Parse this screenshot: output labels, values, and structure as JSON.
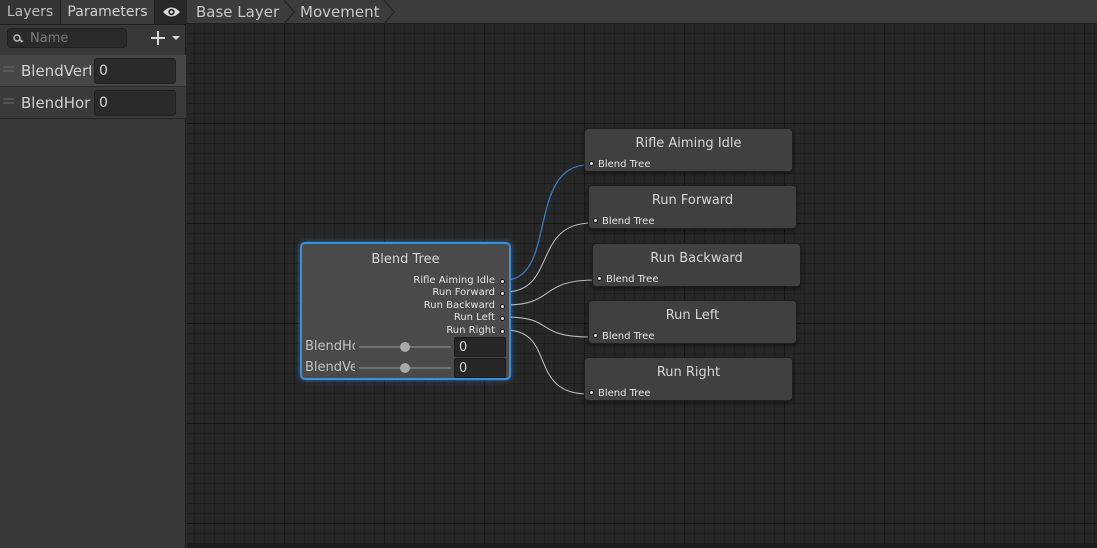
{
  "tabs": {
    "layers": "Layers",
    "parameters": "Parameters"
  },
  "search": {
    "placeholder": "Name",
    "value": ""
  },
  "parameters": [
    {
      "name": "BlendVert",
      "value": "0"
    },
    {
      "name": "BlendHori",
      "value": "0"
    }
  ],
  "breadcrumb": {
    "items": [
      "Base Layer",
      "Movement"
    ]
  },
  "blend_tree": {
    "title": "Blend Tree",
    "outputs": [
      "Rifle Aiming Idle",
      "Run Forward",
      "Run Backward",
      "Run Left",
      "Run Right"
    ],
    "sliders": [
      {
        "label": "BlendHorizontal",
        "value": "0",
        "fraction": 0.5
      },
      {
        "label": "BlendVertical",
        "value": "0",
        "fraction": 0.5
      }
    ]
  },
  "motion_nodes": [
    {
      "title": "Rifle Aiming Idle",
      "port": "Blend Tree"
    },
    {
      "title": "Run Forward",
      "port": "Blend Tree"
    },
    {
      "title": "Run Backward",
      "port": "Blend Tree"
    },
    {
      "title": "Run Left",
      "port": "Blend Tree"
    },
    {
      "title": "Run Right",
      "port": "Blend Tree"
    }
  ],
  "colors": {
    "selection": "#3b8ed8",
    "wire": "#b8b8b8",
    "active_wire": "#3a78c2"
  },
  "icons": {
    "eye": "eye-icon",
    "search": "search-icon",
    "add": "plus-icon",
    "dropdown": "caret-down-icon",
    "drag": "drag-handle-icon"
  }
}
